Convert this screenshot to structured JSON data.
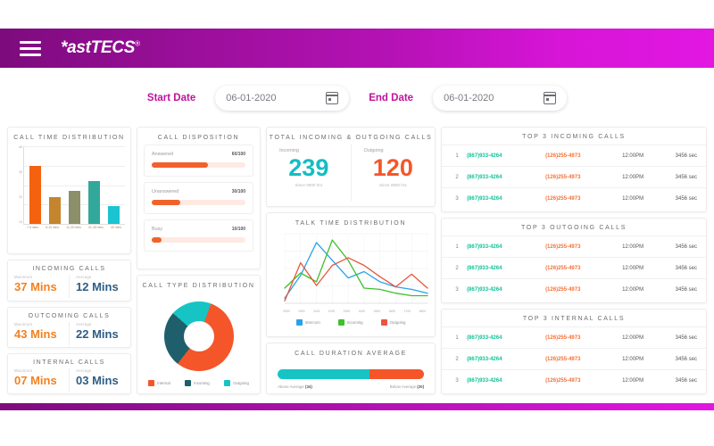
{
  "header": {
    "logo_text": "*astTECS",
    "registered_mark": "®",
    "menu_icon": "hamburger-icon"
  },
  "filters": {
    "start_label": "Start Date",
    "start_value": "06-01-2020",
    "end_label": "End Date",
    "end_value": "06-01-2020",
    "calendar_icon": "calendar-icon"
  },
  "call_time_distribution": {
    "title": "CALL TIME DISTRIBUTION"
  },
  "call_disposition": {
    "title": "CALL DISPOSITION",
    "items": [
      {
        "label": "Answered",
        "count": "60/100",
        "pct": 60
      },
      {
        "label": "Unanswered",
        "count": "30/100",
        "pct": 30
      },
      {
        "label": "Busy",
        "count": "10/100",
        "pct": 10
      }
    ]
  },
  "call_type_distribution": {
    "title": "CALL TYPE DISTRIBUTION",
    "legend": [
      {
        "label": "Internal",
        "color": "#f4562a"
      },
      {
        "label": "Incoming",
        "color": "#1f5f6b"
      },
      {
        "label": "Outgoing",
        "color": "#17c4c4"
      }
    ]
  },
  "stat_cards": [
    {
      "title": "INCOMING CALLS",
      "max_caption": "Maximum",
      "max_value": "37 Mins",
      "avg_caption": "Average",
      "avg_value": "12 Mins"
    },
    {
      "title": "OUTCOMING CALLS",
      "max_caption": "Maximum",
      "max_value": "43 Mins",
      "avg_caption": "Average",
      "avg_value": "22 Mins"
    },
    {
      "title": "INTERNAL CALLS",
      "max_caption": "Maximum",
      "max_value": "07 Mins",
      "avg_caption": "Average",
      "avg_value": "03 Mins"
    }
  ],
  "totals": {
    "title": "TOTAL INCOMING & OUTGOING CALLS",
    "incoming_label": "Incoming",
    "incoming_value": "239",
    "incoming_sub": "Since 0900 hrs",
    "outgoing_label": "Outgoing",
    "outgoing_value": "120",
    "outgoing_sub": "Since 0900 hrs"
  },
  "talk_time": {
    "title": "TALK TIME DISTRIBUTION"
  },
  "call_duration_average": {
    "title": "CALL DURATION AVERAGE",
    "above_label": "Above Average",
    "above_value": "(34)",
    "below_label": "Below Average",
    "below_value": "(20)",
    "above_color": "#17c4c4",
    "below_color": "#f4562a",
    "above_pct": 63
  },
  "tables": [
    {
      "title": "TOP 3 INCOMING CALLS",
      "rows": [
        {
          "idx": "1",
          "from": "(867)933-4264",
          "to": "(126)255-4973",
          "time": "12:00PM",
          "duration": "3456 sec"
        },
        {
          "idx": "2",
          "from": "(867)933-4264",
          "to": "(126)255-4973",
          "time": "12:00PM",
          "duration": "3456 sec"
        },
        {
          "idx": "3",
          "from": "(867)933-4264",
          "to": "(126)255-4973",
          "time": "12:00PM",
          "duration": "3456 sec"
        }
      ]
    },
    {
      "title": "TOP 3 OUTGOING CALLS",
      "rows": [
        {
          "idx": "1",
          "from": "(867)933-4264",
          "to": "(126)255-4973",
          "time": "12:00PM",
          "duration": "3456 sec"
        },
        {
          "idx": "2",
          "from": "(867)933-4264",
          "to": "(126)255-4973",
          "time": "12:00PM",
          "duration": "3456 sec"
        },
        {
          "idx": "3",
          "from": "(867)933-4264",
          "to": "(126)255-4973",
          "time": "12:00PM",
          "duration": "3456 sec"
        }
      ]
    },
    {
      "title": "TOP 3 INTERNAL CALLS",
      "rows": [
        {
          "idx": "1",
          "from": "(867)933-4264",
          "to": "(126)255-4973",
          "time": "12:00PM",
          "duration": "3456 sec"
        },
        {
          "idx": "2",
          "from": "(867)933-4264",
          "to": "(126)255-4973",
          "time": "12:00PM",
          "duration": "3456 sec"
        },
        {
          "idx": "3",
          "from": "(867)933-4264",
          "to": "(126)255-4973",
          "time": "12:00PM",
          "duration": "3456 sec"
        }
      ]
    }
  ],
  "chart_data": [
    {
      "type": "bar",
      "title": "CALL TIME DISTRIBUTION",
      "categories": [
        "< 5 mins",
        "5-10 mins",
        "11-20 mins",
        "21-40 mins",
        "40 mins"
      ],
      "values": [
        30,
        14,
        17,
        22,
        9
      ],
      "colors": [
        "#f4620f",
        "#c5842e",
        "#8b8f6a",
        "#32a89b",
        "#1ac4d0"
      ],
      "ylabel": "",
      "xlabel": "",
      "ylim": [
        0,
        40
      ],
      "yticks": [
        40,
        30,
        20,
        10
      ],
      "grid": true
    },
    {
      "type": "pie",
      "title": "CALL TYPE DISTRIBUTION",
      "labels": [
        "Internal",
        "Incoming",
        "Outgoing"
      ],
      "values": [
        55,
        26,
        19
      ],
      "colors": [
        "#f4562a",
        "#1f5f6b",
        "#17c4c4"
      ],
      "donut": true,
      "legend": "bottom"
    },
    {
      "type": "line",
      "title": "TALK TIME DISTRIBUTION",
      "x": [
        "0900",
        "1000",
        "1100",
        "1200",
        "1300",
        "1400",
        "1500",
        "1600",
        "1700",
        "1800"
      ],
      "series": [
        {
          "name": "Intercom",
          "color": "#29a3e8",
          "values": [
            4,
            22,
            48,
            34,
            20,
            25,
            17,
            13,
            11,
            8
          ]
        },
        {
          "name": "Incoming",
          "color": "#3fc02c",
          "values": [
            12,
            24,
            17,
            50,
            34,
            12,
            11,
            8,
            6,
            6
          ]
        },
        {
          "name": "Outgoing",
          "color": "#e8563c",
          "values": [
            2,
            32,
            14,
            30,
            36,
            30,
            21,
            13,
            23,
            12
          ]
        }
      ],
      "ylim": [
        0,
        55
      ],
      "legend": "bottom",
      "grid": true
    },
    {
      "type": "bar",
      "title": "CALL DURATION AVERAGE",
      "categories": [
        "Above Average",
        "Below Average"
      ],
      "values": [
        34,
        20
      ],
      "colors": [
        "#17c4c4",
        "#f4562a"
      ],
      "orientation": "horizontal-stacked"
    }
  ]
}
